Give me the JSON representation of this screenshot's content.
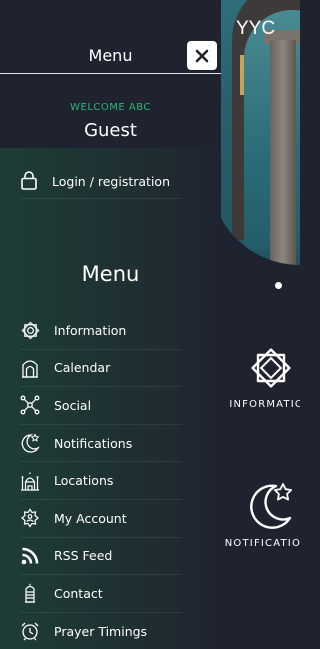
{
  "background": {
    "city": "YYC",
    "tiles": [
      {
        "label": "INFORMATION",
        "icon": "octagram-star-icon"
      },
      {
        "label": "NOTIFICATIONS",
        "icon": "crescent-star-icon"
      }
    ]
  },
  "drawer": {
    "header_title": "Menu",
    "welcome": "WELCOME ABC",
    "user_name": "Guest",
    "login": {
      "label": "Login / registration",
      "icon": "lock-icon"
    },
    "section_title": "Menu",
    "items": [
      {
        "label": "Information",
        "icon": "octagram-icon"
      },
      {
        "label": "Calendar",
        "icon": "mosque-arch-icon"
      },
      {
        "label": "Social",
        "icon": "network-icon"
      },
      {
        "label": "Notifications",
        "icon": "crescent-star-icon"
      },
      {
        "label": "Locations",
        "icon": "mosque-icon"
      },
      {
        "label": "My Account",
        "icon": "account-star-icon"
      },
      {
        "label": "RSS Feed",
        "icon": "rss-icon"
      },
      {
        "label": "Contact",
        "icon": "lantern-icon"
      },
      {
        "label": "Prayer Timings",
        "icon": "alarm-clock-icon"
      }
    ]
  },
  "colors": {
    "accent_green": "#2bb673",
    "background": "#1f2330",
    "drawer_gradient_start": "#1e3d36"
  }
}
